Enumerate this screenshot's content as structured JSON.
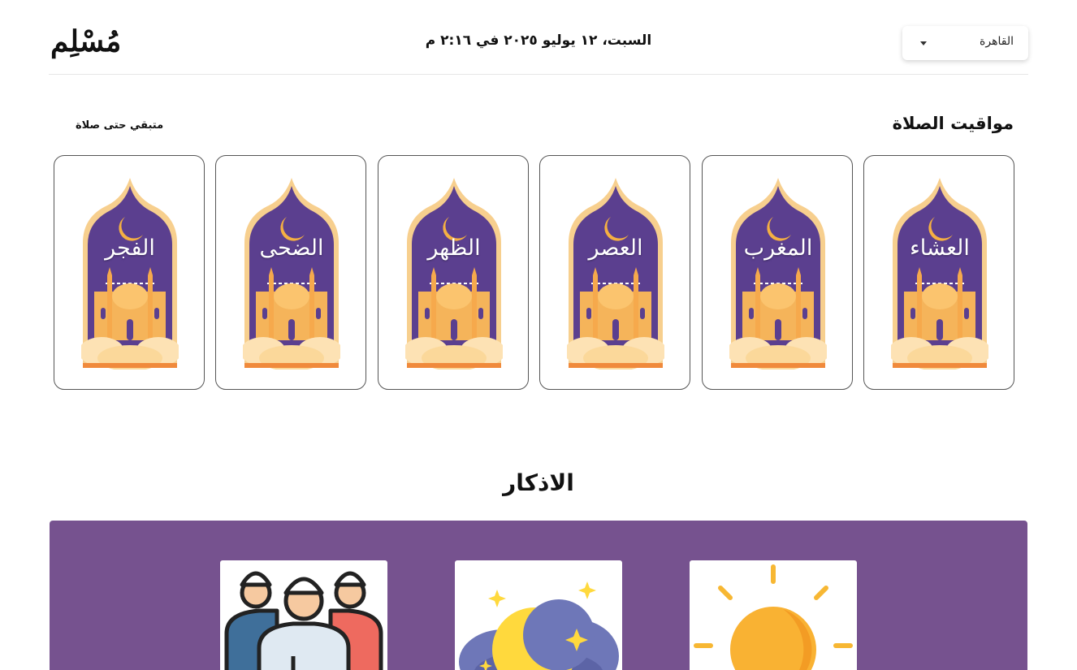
{
  "header": {
    "logo": "مُسْلِم",
    "date_text": "السبت، ١٢ يوليو ٢٠٢٥ في ٢:١٦ م",
    "city": "القاهرة"
  },
  "prayers": {
    "title": "مواقيت الصلاة",
    "remaining_label": "متبقي حتى صلاة",
    "cards": [
      {
        "name": "العشاء"
      },
      {
        "name": "المغرب"
      },
      {
        "name": "العصر"
      },
      {
        "name": "الظهر"
      },
      {
        "name": "الضحى"
      },
      {
        "name": "الفجر"
      }
    ]
  },
  "azkar": {
    "title": "الاذكار",
    "tiles": [
      {
        "icon": "sun-icon"
      },
      {
        "icon": "moon-night-icon"
      },
      {
        "icon": "worshippers-icon"
      }
    ]
  },
  "colors": {
    "purple_panel": "#76528f",
    "card_night": "#5b3f8f",
    "mosque_gold": "#f5b45a",
    "frame_orange": "#f08a3c"
  }
}
